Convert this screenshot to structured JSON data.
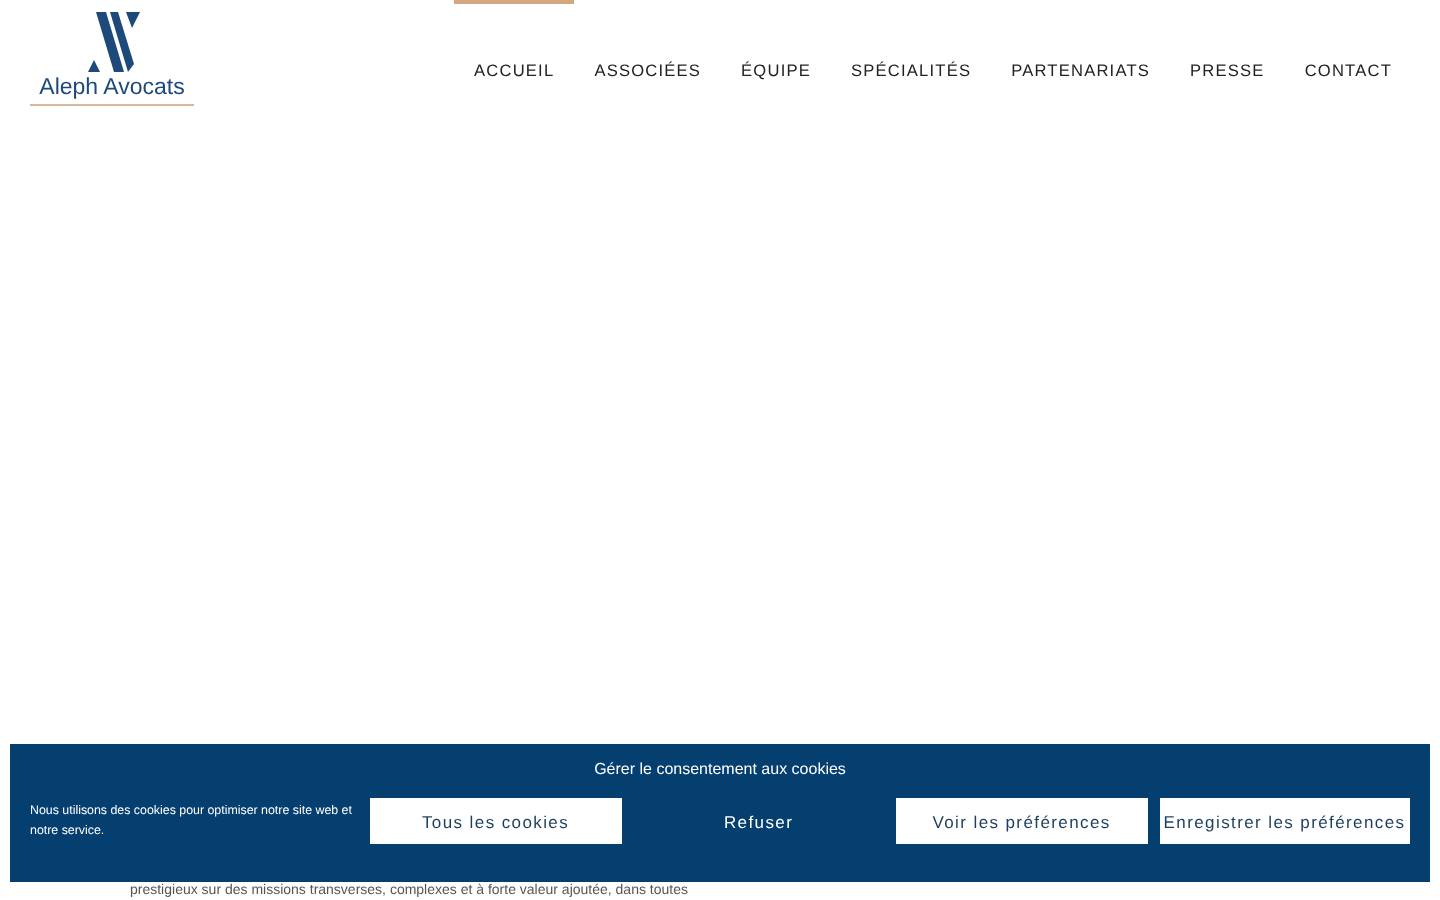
{
  "logo": {
    "text": "Aleph Avocats"
  },
  "nav": [
    {
      "label": "ACCUEIL",
      "selected": true
    },
    {
      "label": "ASSOCIÉES",
      "selected": false
    },
    {
      "label": "ÉQUIPE",
      "selected": false
    },
    {
      "label": "SPÉCIALITÉS",
      "selected": false
    },
    {
      "label": "PARTENARIATS",
      "selected": false
    },
    {
      "label": "PRESSE",
      "selected": false
    },
    {
      "label": "CONTACT",
      "selected": false
    }
  ],
  "body_text": "prestigieux sur des missions transverses, complexes et à forte valeur ajoutée, dans toutes",
  "cookie_banner": {
    "title": "Gérer le consentement aux cookies",
    "message": "Nous utilisons des cookies pour optimiser notre site web et notre service.",
    "buttons": [
      {
        "label": "Tous les cookies",
        "kind": "filled"
      },
      {
        "label": "Refuser",
        "kind": "plain"
      },
      {
        "label": "Voir les préférences",
        "kind": "filled"
      },
      {
        "label": "Enregistrer les préférences",
        "kind": "filled"
      }
    ]
  }
}
